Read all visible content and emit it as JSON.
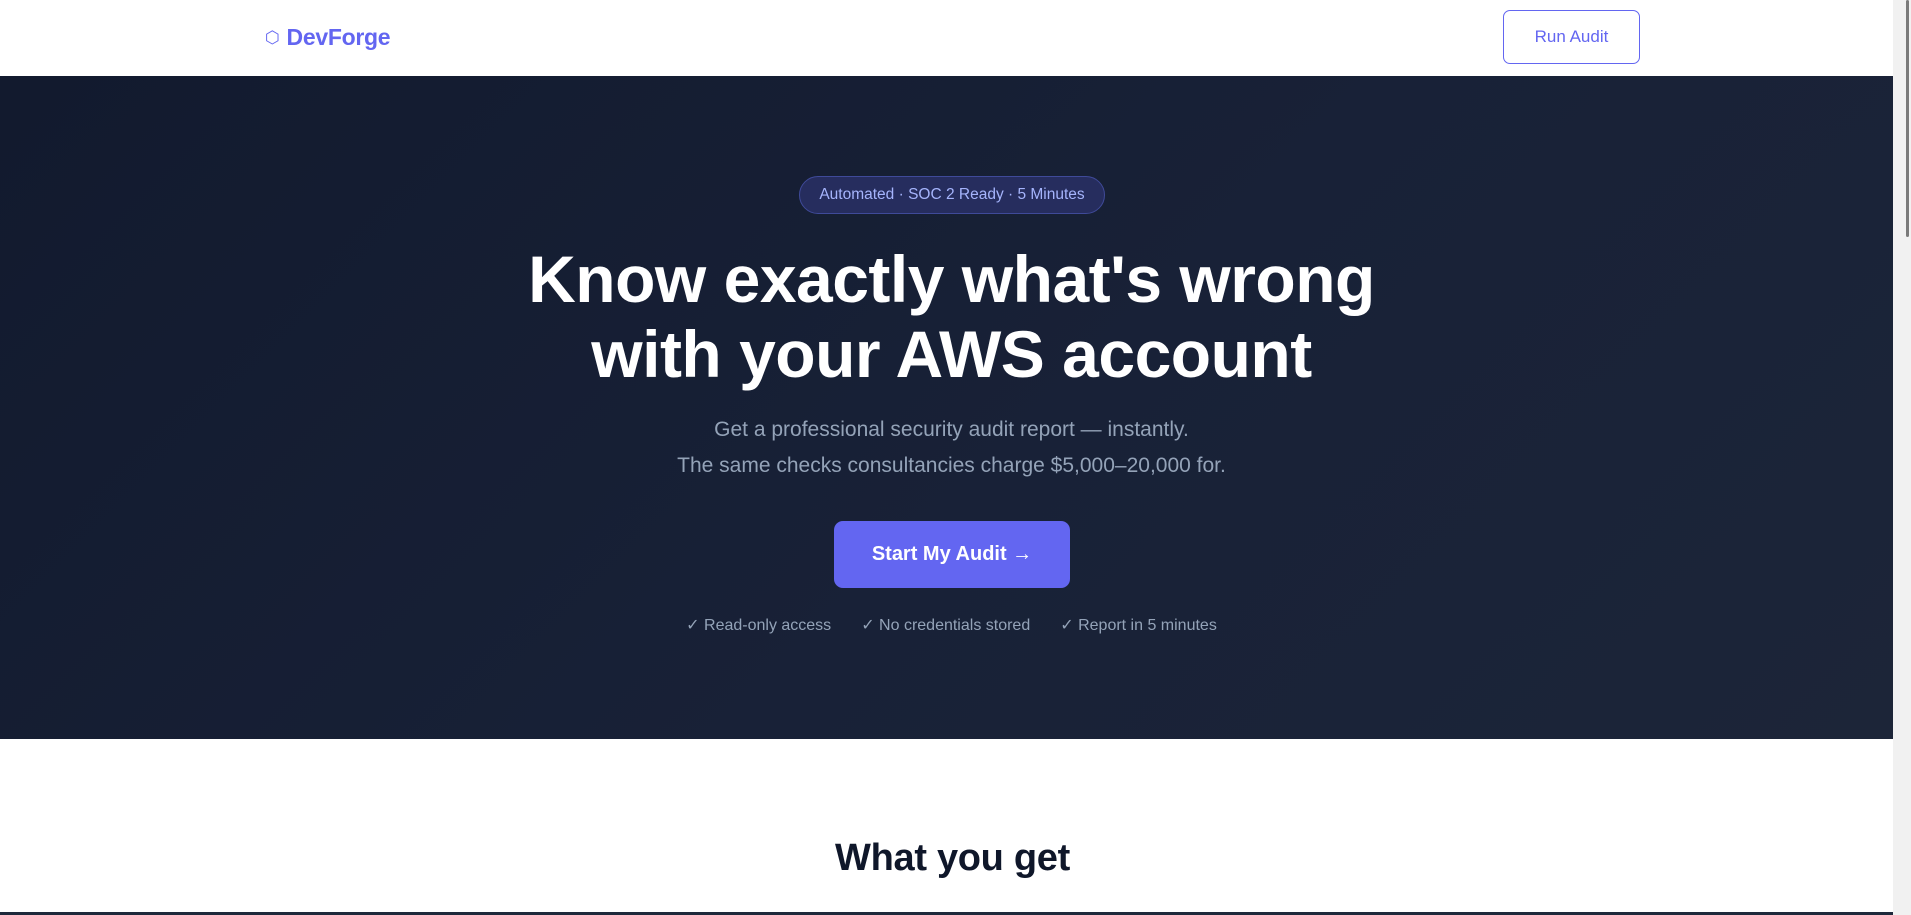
{
  "header": {
    "brand_icon": "hexagon-icon",
    "brand_glyph": "⬡",
    "brand_name": "DevForge",
    "nav_button_label": "Run Audit"
  },
  "hero": {
    "badge": "Automated · SOC 2 Ready · 5 Minutes",
    "title_lines": [
      "Know exactly what's wrong",
      "with your AWS account"
    ],
    "subtitle_lines": [
      "Get a professional security audit report — instantly.",
      "The same checks consultancies charge $5,000–20,000 for."
    ],
    "cta_label": "Start My Audit →",
    "trust_items": [
      "✓ Read-only access",
      "✓ No credentials stored",
      "✓ Report in 5 minutes"
    ]
  },
  "features": {
    "title": "What you get"
  },
  "colors": {
    "accent": "#6366f1",
    "hero_background": "#151d31",
    "muted_text": "#94a3b8",
    "badge_text": "#a5b4fc"
  }
}
